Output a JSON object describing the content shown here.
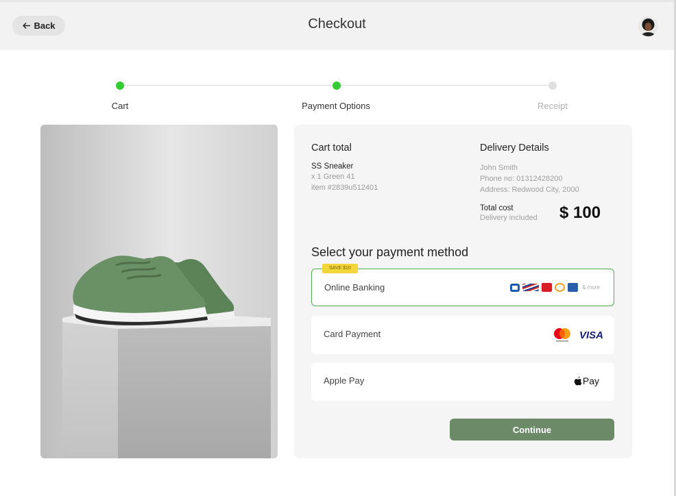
{
  "header": {
    "back_label": "Back",
    "title": "Checkout"
  },
  "stepper": {
    "steps": [
      {
        "label": "Cart",
        "state": "complete"
      },
      {
        "label": "Payment Options",
        "state": "current"
      },
      {
        "label": "Receipt",
        "state": "pending"
      }
    ]
  },
  "cart": {
    "heading": "Cart total",
    "item_name": "SS Sneaker",
    "item_variant": "x 1 Green 41",
    "item_id": "item #2839u512401"
  },
  "delivery": {
    "heading": "Delivery Details",
    "name": "John Smith",
    "phone": "Phone no: 01312428200",
    "address": "Address: Redwood City, 2000",
    "total_label": "Total cost",
    "total_note": "Delivery included",
    "total_amount": "$ 100"
  },
  "payment": {
    "heading": "Select your payment method",
    "options": [
      {
        "label": "Online Banking",
        "badge": "SAVE $10",
        "more": "& more",
        "selected": true
      },
      {
        "label": "Card Payment",
        "brands": [
          "mastercard",
          "VISA"
        ],
        "selected": false
      },
      {
        "label": "Apple Pay",
        "brand_text": "Pay",
        "selected": false
      }
    ],
    "continue_label": "Continue"
  },
  "colors": {
    "accent_green": "#33cc33",
    "continue_button": "#6c8a68",
    "selected_border": "#4caf50",
    "badge_yellow": "#f3d53c"
  }
}
